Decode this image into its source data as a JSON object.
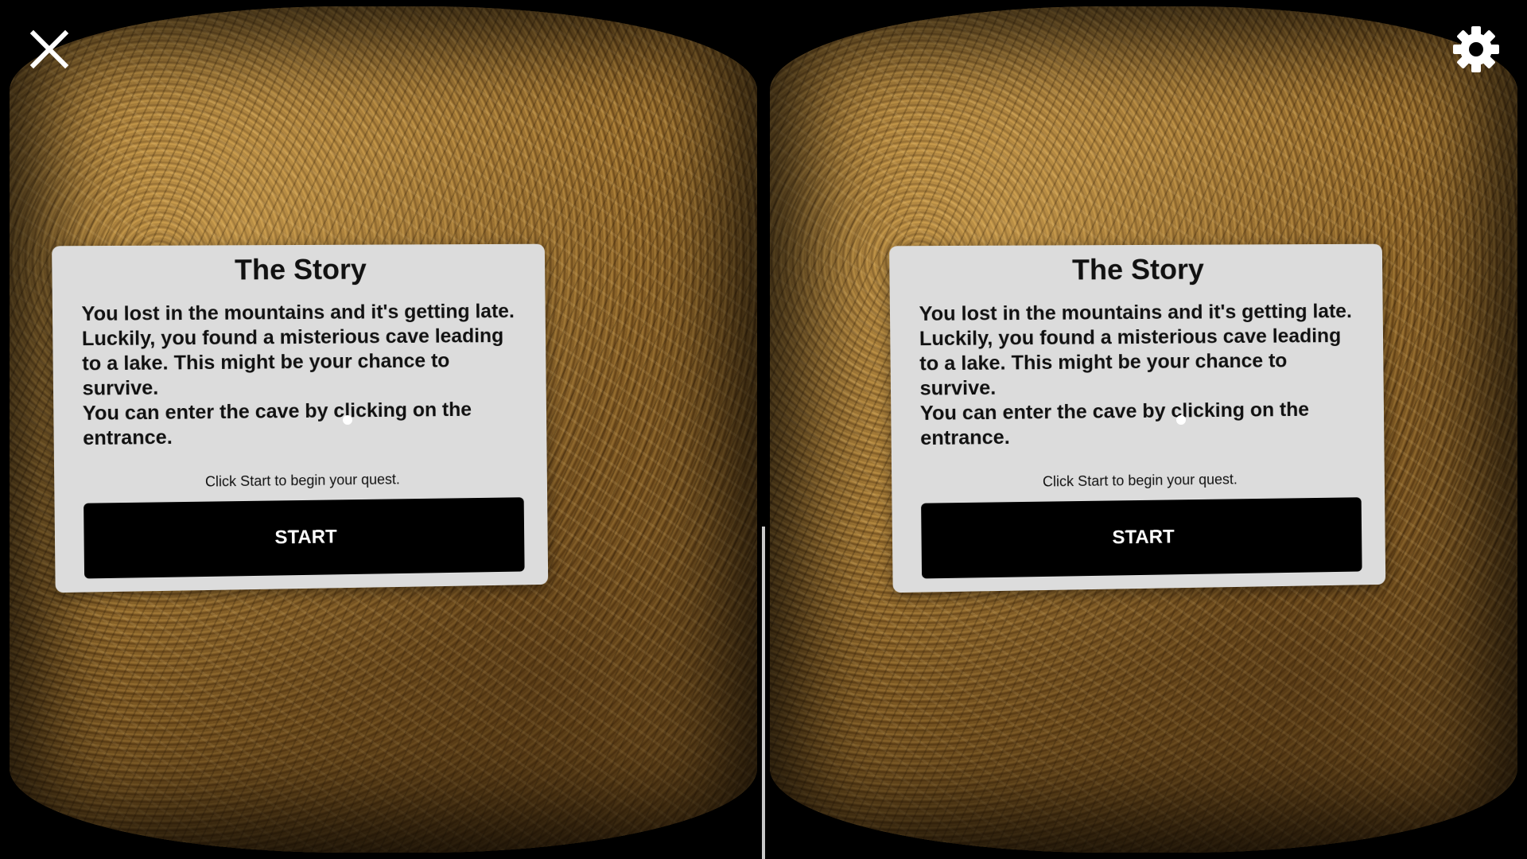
{
  "controls": {
    "close_icon": "close-icon",
    "settings_icon": "gear-icon"
  },
  "dialog": {
    "title": "The Story",
    "paragraph_1": "You lost in the mountains and it's getting late. Luckily, you found a misterious cave leading to a lake. This might be your chance to survive.",
    "paragraph_2": "You can enter the cave by clicking on the entrance.",
    "hint": "Click Start to begin your quest.",
    "start_label": "START"
  },
  "colors": {
    "panel_bg": "#dcdcdc",
    "button_bg": "#000000",
    "button_text": "#ffffff"
  }
}
